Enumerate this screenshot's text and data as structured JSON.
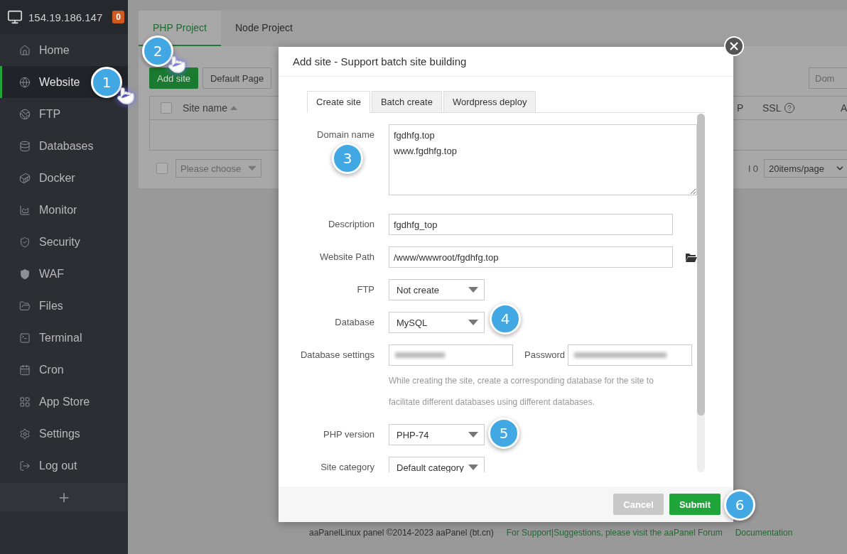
{
  "sidebar": {
    "server_ip": "154.19.186.147",
    "badge": "0",
    "items": [
      {
        "label": "Home",
        "selected": false
      },
      {
        "label": "Website",
        "selected": true
      },
      {
        "label": "FTP",
        "selected": false
      },
      {
        "label": "Databases",
        "selected": false
      },
      {
        "label": "Docker",
        "selected": false
      },
      {
        "label": "Monitor",
        "selected": false
      },
      {
        "label": "Security",
        "selected": false
      },
      {
        "label": "WAF",
        "selected": false
      },
      {
        "label": "Files",
        "selected": false
      },
      {
        "label": "Terminal",
        "selected": false
      },
      {
        "label": "Cron",
        "selected": false
      },
      {
        "label": "App Store",
        "selected": false
      },
      {
        "label": "Settings",
        "selected": false
      },
      {
        "label": "Log out",
        "selected": false
      }
    ],
    "add": "+"
  },
  "main": {
    "tabs": [
      {
        "label": "PHP Project",
        "selected": true
      },
      {
        "label": "Node Project",
        "selected": false
      }
    ],
    "toolbar": [
      {
        "label": "Add site",
        "kind": "primary"
      },
      {
        "label": "Default Page",
        "kind": "default"
      }
    ],
    "search_placeholder": "Dom",
    "select_all_checked": false,
    "batch_checked": false,
    "columns": [
      {
        "label": "Site name",
        "kind": "sortable"
      },
      {
        "label": "P",
        "kind": "plain"
      },
      {
        "label": "SSL",
        "kind": "help"
      },
      {
        "label": "A",
        "kind": "plain"
      }
    ],
    "batch_select": "Please choose",
    "total": "l 0",
    "page_size": "20items/page"
  },
  "footer": {
    "copyright": "aaPanelLinux panel ©2014-2023 aaPanel (bt.cn)",
    "links": [
      "For Support|Suggestions, please visit the aaPanel Forum",
      "Documentation"
    ]
  },
  "dialog": {
    "title": "Add site - Support batch site building",
    "tabs": [
      {
        "label": "Create site",
        "selected": true
      },
      {
        "label": "Batch create",
        "selected": false
      },
      {
        "label": "Wordpress deploy",
        "selected": false
      }
    ],
    "fields": [
      {
        "kind": "textarea",
        "label": "Domain name",
        "value": "fgdhfg.top\nwww.fgdhfg.top"
      },
      {
        "kind": "text",
        "label": "Description",
        "value": "fgdhfg_top"
      },
      {
        "kind": "path",
        "label": "Website Path",
        "value": "/www/wwwroot/fgdhfg.top"
      },
      {
        "kind": "select",
        "label": "FTP",
        "value": "Not create"
      },
      {
        "kind": "select",
        "label": "Database",
        "value": "MySQL"
      },
      {
        "kind": "credentials",
        "label": "Database settings",
        "password_label": "Password",
        "hint": "While creating the site, create a corresponding database for the site to facilitate different databases using different databases."
      },
      {
        "kind": "select",
        "label": "PHP version",
        "value": "PHP-74"
      },
      {
        "kind": "select",
        "label": "Site category",
        "value": "Default category"
      }
    ],
    "buttons": [
      {
        "label": "Cancel",
        "kind": "cancel"
      },
      {
        "label": "Submit",
        "kind": "submit"
      }
    ]
  },
  "callouts": [
    {
      "label": "1",
      "pointer": true
    },
    {
      "label": "2",
      "pointer": true
    },
    {
      "label": "3",
      "pointer": false
    },
    {
      "label": "4",
      "pointer": false
    },
    {
      "label": "5",
      "pointer": false
    },
    {
      "label": "6",
      "pointer": false
    }
  ]
}
